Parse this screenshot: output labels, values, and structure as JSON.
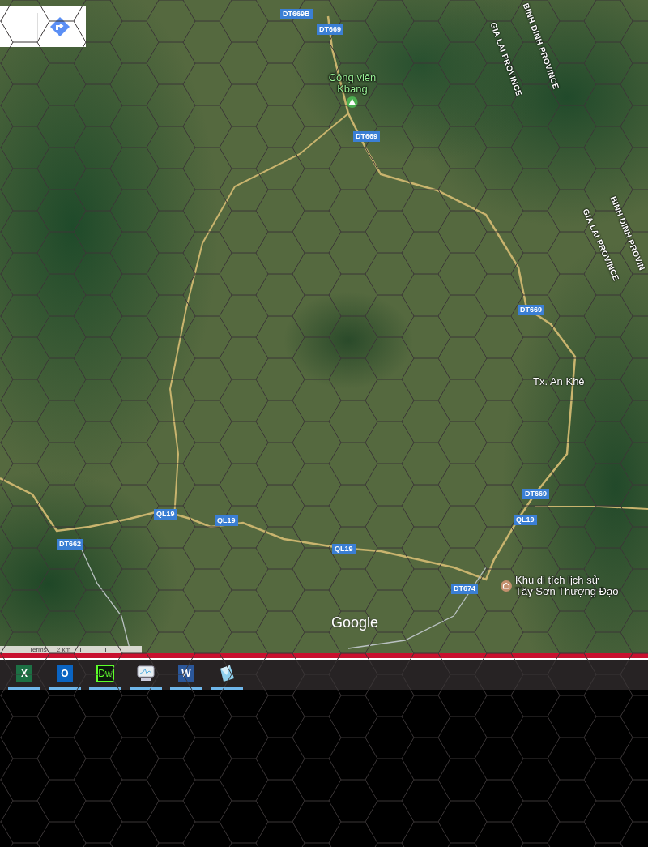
{
  "road_labels": [
    "DT669B",
    "DT669",
    "DT669",
    "DT669",
    "DT669",
    "QL19",
    "QL19",
    "QL19",
    "QL19",
    "DT662",
    "DT674"
  ],
  "places": [
    {
      "kind": "park",
      "lines": [
        "Công viên",
        "Kbang"
      ]
    },
    {
      "kind": "town",
      "lines": [
        "Tx. An Khê"
      ]
    },
    {
      "kind": "landmark",
      "lines": [
        "Khu di tích lịch sử",
        "Tây Sơn Thượng Đạo"
      ]
    }
  ],
  "province_labels": [
    "BINH DINH PROVINCE",
    "GIA LAI PROVINCE",
    "GIA LAI PROVINCE",
    "BINH DINH PROVIN"
  ],
  "logo": "Google",
  "attribution": [
    "Terms",
    "2 km"
  ],
  "taskbar": {
    "apps": [
      {
        "kind": "spreadsheet",
        "letter": "X"
      },
      {
        "kind": "mail",
        "letter": "O"
      },
      {
        "kind": "web-editor",
        "letter": "Dw"
      },
      {
        "kind": "monitor"
      },
      {
        "kind": "document",
        "letter": "W"
      },
      {
        "kind": "crystal"
      }
    ]
  }
}
